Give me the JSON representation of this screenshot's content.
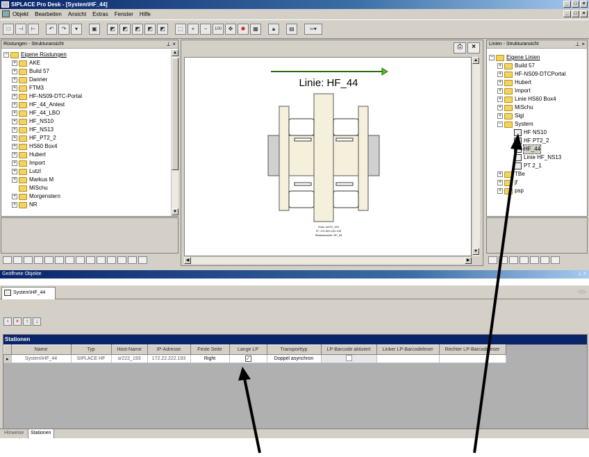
{
  "window": {
    "title": "SIPLACE Pro Desk - [System\\HF_44]"
  },
  "menu": [
    "Objekt",
    "Bearbeiten",
    "Ansicht",
    "Extras",
    "Fenster",
    "Hilfe"
  ],
  "left_panel": {
    "title": "Rüstungen - Strukturansicht",
    "root": "Eigene Rüstungen",
    "items": [
      "AKE",
      "Build 57",
      "Danner",
      "FTM3",
      "HF-NS09-DTC-Portal",
      "HF_44_Antest",
      "HF_44_LBO",
      "HF_NS10",
      "HF_NS13",
      "HF_PT2_2",
      "HS60 Box4",
      "Hubert",
      "Import",
      "Lutzl",
      "Markus M",
      "MiSchu",
      "Morgenstern",
      "NR"
    ]
  },
  "center": {
    "line_title": "Linie: HF_44",
    "info_lines": [
      "Host: sr222_193",
      "IP: 172.022.222.193",
      "Stationsname: HF_44"
    ]
  },
  "right_panel": {
    "title": "Linien - Strukturansicht",
    "root": "Eigene Linien",
    "items": [
      "Build 57",
      "HF-NS09-DTCPortal",
      "Hubert",
      "Import",
      "Linie HS60 Box4",
      "MiSchu",
      "Sigi",
      "System"
    ],
    "system_children": [
      "HF NS10",
      "HF PT2_2",
      "HF_44",
      "Linie HF_NS13",
      "PT 2_1"
    ],
    "after": [
      "TBe",
      "jf",
      "psp"
    ]
  },
  "open_objects": {
    "title": "Geöffnete Objekte",
    "tab": "System\\HF_44"
  },
  "stations": {
    "title": "Stationen",
    "columns": [
      "Name",
      "Typ",
      "Host-Name",
      "IP-Adresse",
      "Feste Seite",
      "Lange LP",
      "Transporttyp",
      "LP-Barcode aktiviert",
      "Linker LP-Barcodeleser",
      "Rechter LP-Barcodeleser"
    ],
    "rows": [
      {
        "name": "System\\HF_44",
        "typ": "SIPLACE HF",
        "host": "sr222_193",
        "ip": "172.22.222.193",
        "side": "Right",
        "lange_lp": true,
        "transport": "Doppel asynchron",
        "barcode": false,
        "left_reader": "",
        "right_reader": ""
      }
    ]
  },
  "bottom_tabs": [
    "Hinweise",
    "Stationen"
  ]
}
